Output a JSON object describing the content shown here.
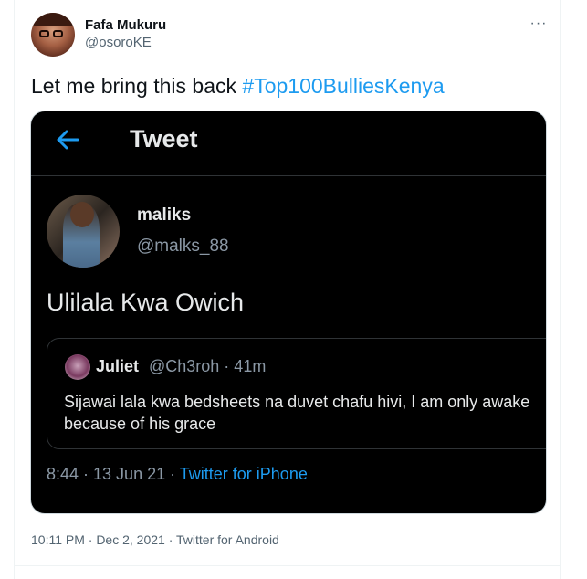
{
  "author": {
    "display_name": "Fafa Mukuru",
    "handle": "@osoroKE"
  },
  "more_icon": "more-horizontal-icon",
  "tweet": {
    "text": "Let me bring this back ",
    "hashtag": "#Top100BulliesKenya"
  },
  "embedded_screenshot": {
    "header_title": "Tweet",
    "back_icon": "arrow-left-icon",
    "accent_color": "#1d9bf0",
    "author_name": "maliks",
    "author_handle": "@malks_88",
    "text": "Ulilala Kwa Owich",
    "quote": {
      "name": "Juliet",
      "handle_time": "@Ch3roh · 41m",
      "line1": "Sijawai lala kwa bedsheets na duvet chafu hivi, I am only awake",
      "line2": "because of his grace"
    },
    "footer_time": "8:44 · 13 Jun 21 · ",
    "footer_source": "Twitter for iPhone"
  },
  "timestamp": "10:11 PM · Dec 2, 2021 · Twitter for Android"
}
